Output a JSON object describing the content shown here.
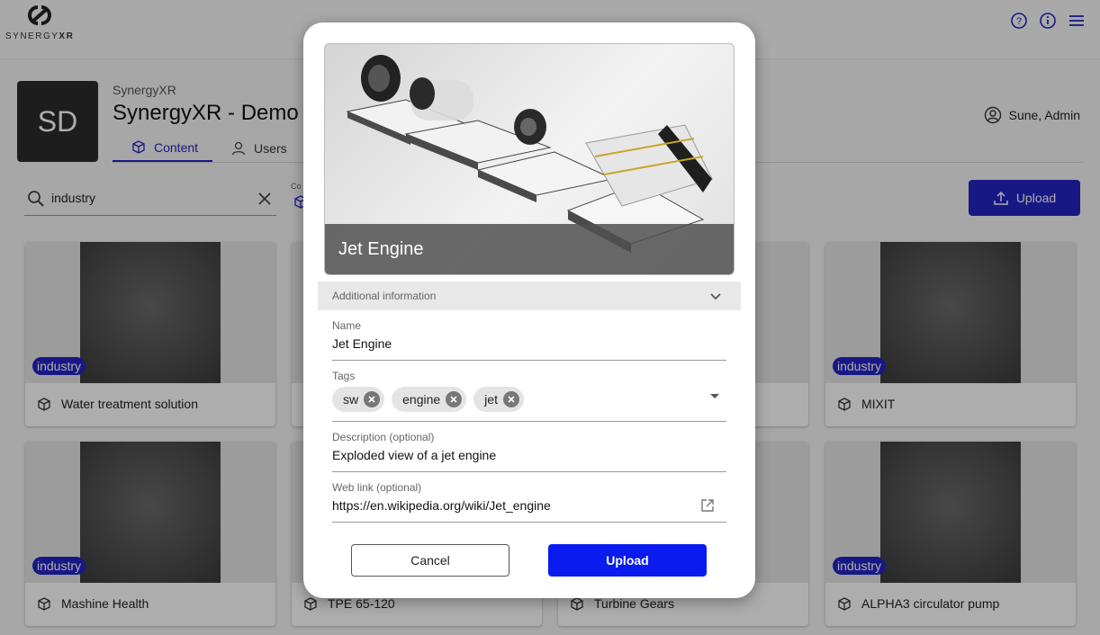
{
  "app": {
    "logo_text_a": "SYNERGY",
    "logo_text_b": "XR"
  },
  "org": {
    "initials": "SD",
    "subtitle": "SynergyXR",
    "title": "SynergyXR - Demo"
  },
  "tabs": [
    {
      "label": "Content",
      "active": true
    },
    {
      "label": "Users",
      "active": false
    }
  ],
  "user": {
    "name": "Sune, Admin"
  },
  "search": {
    "value": "industry"
  },
  "filter": {
    "label": "Co"
  },
  "toolbar": {
    "upload_label": "Upload"
  },
  "cards": [
    {
      "label": "Water treatment solution",
      "tag": "industry"
    },
    {
      "label": "MIXIT",
      "tag": "industry"
    },
    {
      "label": "Mashine Health",
      "tag": "industry"
    },
    {
      "label": "TPE 65-120",
      "tag": ""
    },
    {
      "label": "Turbine Gears",
      "tag": ""
    },
    {
      "label": "ALPHA3 circulator pump",
      "tag": "industry"
    }
  ],
  "modal": {
    "preview_title": "Jet Engine",
    "section_label": "Additional information",
    "name_label": "Name",
    "name_value": "Jet Engine",
    "tags_label": "Tags",
    "tags": [
      "sw",
      "engine",
      "jet"
    ],
    "description_label": "Description (optional)",
    "description_value": "Exploded view of a jet engine",
    "weblink_label": "Web link (optional)",
    "weblink_value": "https://en.wikipedia.org/wiki/Jet_engine",
    "cancel_label": "Cancel",
    "upload_label": "Upload"
  },
  "colors": {
    "accent": "#2424c4",
    "upload": "#0a1bf0",
    "badge": "#2424c4"
  }
}
